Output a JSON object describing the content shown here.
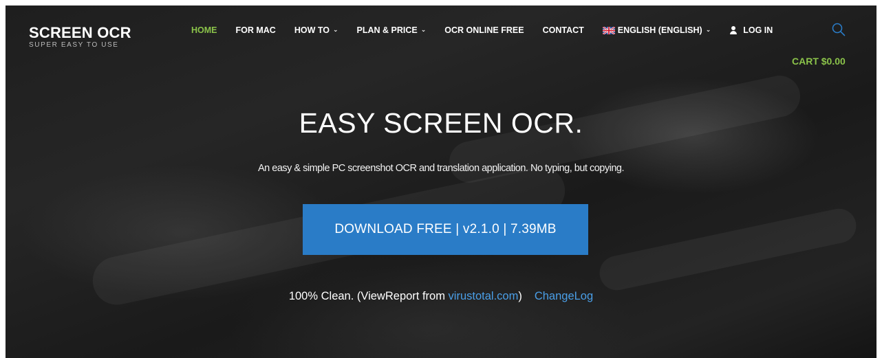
{
  "logo": {
    "title": "SCREEN OCR",
    "subtitle": "SUPER EASY TO USE"
  },
  "nav": {
    "home": "HOME",
    "for_mac": "FOR MAC",
    "how_to": "HOW TO",
    "plan_price": "PLAN & PRICE",
    "ocr_online": "OCR ONLINE FREE",
    "contact": "CONTACT",
    "language": "ENGLISH (ENGLISH)",
    "login": "LOG IN"
  },
  "cart": {
    "label": "CART $0.00"
  },
  "hero": {
    "title": "EASY SCREEN OCR.",
    "tagline": "An easy & simple PC screenshot OCR and translation application. No typing, but copying.",
    "download_label": "DOWNLOAD FREE | v2.1.0 | 7.39MB",
    "clean_prefix": "100% Clean. (ViewReport from ",
    "virustotal_link": "virustotal.com",
    "clean_suffix": ")",
    "changelog_link": "ChangeLog"
  },
  "icons": {
    "search": "search-icon",
    "user": "user-icon",
    "flag": "uk-flag-icon",
    "chevron": "chevron-down-icon"
  },
  "colors": {
    "accent_green": "#8bc34a",
    "button_blue": "#2a7cc7",
    "link_blue": "#4a9fe8",
    "hero_dark": "#1e1e1e"
  }
}
